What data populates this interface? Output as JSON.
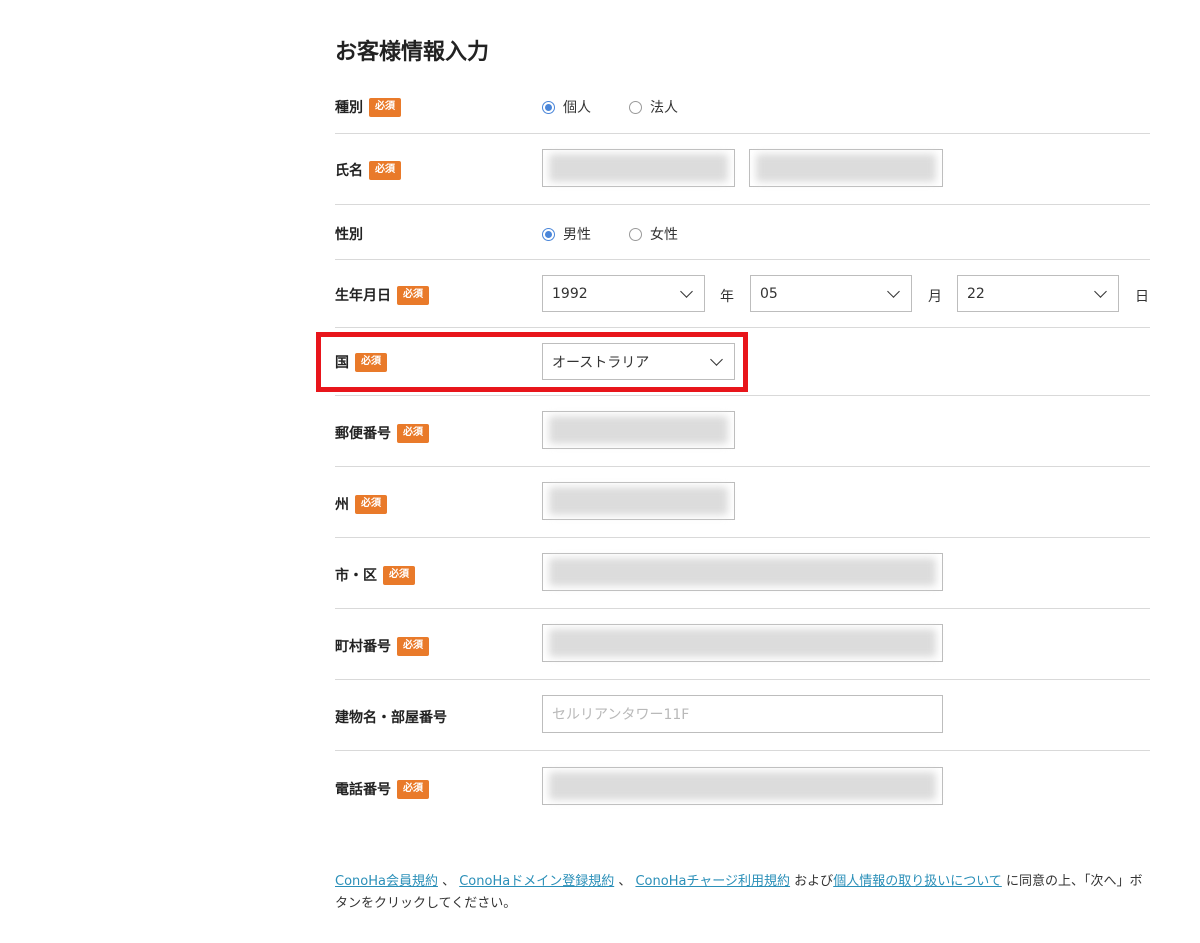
{
  "page_title": "お客様情報入力",
  "required_badge": "必須",
  "fields": {
    "type": {
      "label": "種別",
      "options": [
        "個人",
        "法人"
      ],
      "selected": 0
    },
    "name": {
      "label": "氏名"
    },
    "gender": {
      "label": "性別",
      "options": [
        "男性",
        "女性"
      ],
      "selected": 0
    },
    "birthdate": {
      "label": "生年月日",
      "year": "1992",
      "year_unit": "年",
      "month": "05",
      "month_unit": "月",
      "day": "22",
      "day_unit": "日"
    },
    "country": {
      "label": "国",
      "value": "オーストラリア"
    },
    "postal": {
      "label": "郵便番号"
    },
    "state": {
      "label": "州"
    },
    "city": {
      "label": "市・区"
    },
    "street": {
      "label": "町村番号"
    },
    "building": {
      "label": "建物名・部屋番号",
      "placeholder": "セルリアンタワー11F"
    },
    "phone": {
      "label": "電話番号"
    }
  },
  "footer": {
    "link1": "ConoHa会員規約",
    "sep1": " 、 ",
    "link2": "ConoHaドメイン登録規約",
    "sep2": " 、 ",
    "link3": "ConoHaチャージ利用規約",
    "and": " および",
    "link4": "個人情報の取り扱いについて",
    "tail": " に同意の上、「次へ」ボタンをクリックしてください。"
  },
  "colors": {
    "badge": "#e97a2a",
    "link": "#2a8fb8",
    "highlight": "#e8151b",
    "radio": "#4a86d9"
  }
}
